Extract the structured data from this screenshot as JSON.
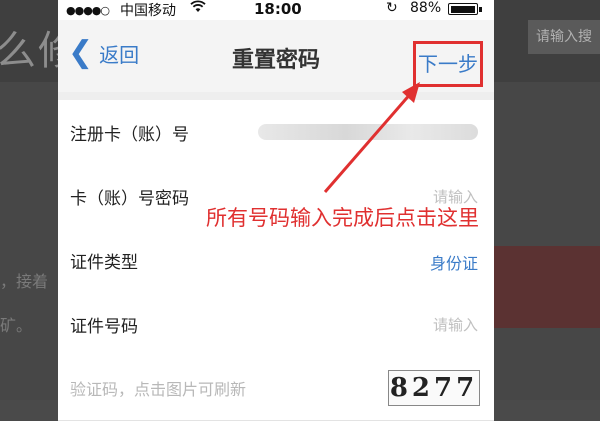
{
  "background": {
    "title_fragment": "么修",
    "search_placeholder": "请输入搜",
    "text_line1": "，接着",
    "text_line2": "矿。"
  },
  "status_bar": {
    "signal": "●●●●○",
    "carrier": "中国移动",
    "wifi_icon": "wifi-icon",
    "time": "18:00",
    "battery_percent": "88%",
    "battery_level": 0.88
  },
  "navbar": {
    "back_label": "返回",
    "title": "重置密码",
    "next_label": "下一步"
  },
  "form": {
    "rows": [
      {
        "label": "注册卡（账）号",
        "value": ""
      },
      {
        "label": "卡（账）号密码",
        "value": "请输入"
      },
      {
        "label": "证件类型",
        "value": "身份证"
      },
      {
        "label": "证件号码",
        "value": "请输入"
      },
      {
        "label": "验证码，点击图片可刷新",
        "value": "8277"
      }
    ]
  },
  "annotation": {
    "text": "所有号码输入完成后点击这里",
    "color": "#e03030"
  },
  "colors": {
    "accent_blue": "#3a7bc8",
    "highlight_red": "#e03030"
  }
}
